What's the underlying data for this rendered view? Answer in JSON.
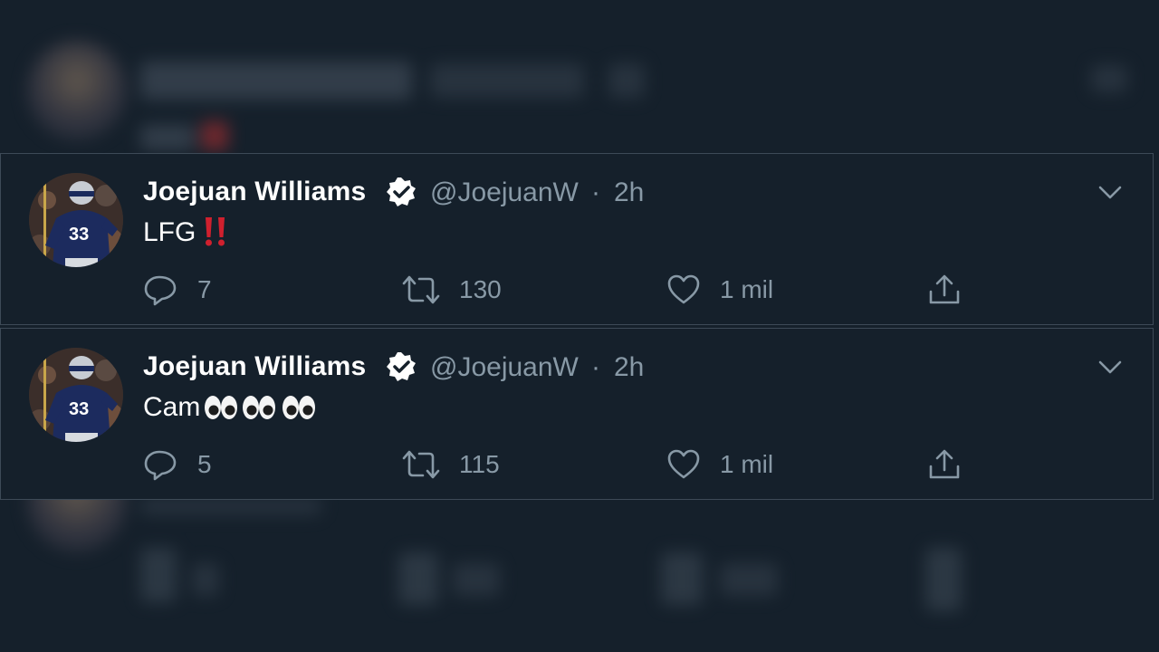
{
  "tweets": [
    {
      "name": "Joejuan Williams",
      "handle": "@JoejuanW",
      "separator": "·",
      "time": "2h",
      "text": "LFG",
      "emoji": "‼️",
      "replies": "7",
      "retweets": "130",
      "likes": "1 mil",
      "jersey": "33"
    },
    {
      "name": "Joejuan Williams",
      "handle": "@JoejuanW",
      "separator": "·",
      "time": "2h",
      "text": "Cam",
      "emoji": "👀👀👀",
      "replies": "5",
      "retweets": "115",
      "likes": "1 mil",
      "jersey": "33"
    }
  ],
  "icons": {
    "verified": "verified-badge-icon",
    "caret": "chevron-down-icon",
    "reply": "reply-icon",
    "retweet": "retweet-icon",
    "like": "heart-icon",
    "share": "share-icon"
  },
  "colors": {
    "background": "#15202b",
    "border": "#3d4a57",
    "secondary_text": "#8899a6",
    "primary_text": "#ffffff",
    "bang_red": "#d0202e"
  }
}
